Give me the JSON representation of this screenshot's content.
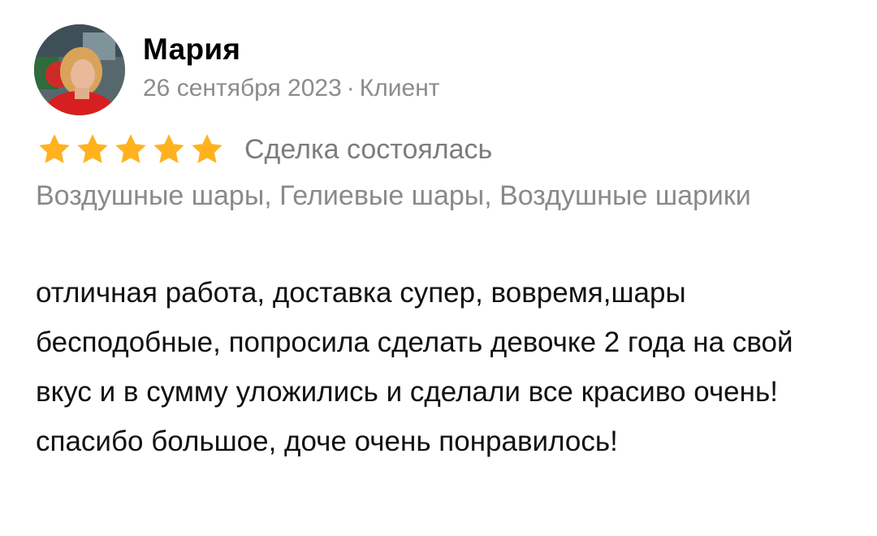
{
  "review": {
    "author": "Мария",
    "date": "26 сентября 2023",
    "separator": "·",
    "role": "Клиент",
    "rating": 5,
    "rating_max": 5,
    "deal_status": "Сделка состоялась",
    "categories": "Воздушные шары, Гелиевые шары, Воздушные шарики",
    "text": "отличная работа, доставка супер, вовремя,шары бесподобные, попросила сделать девочке 2 года на свой вкус и в сумму уложились и сделали все красиво очень! спасибо большое, доче очень понравилось!"
  },
  "colors": {
    "star": "#ffb21e",
    "muted_text": "#8c8c8c",
    "body_text": "#111111"
  },
  "icons": {
    "avatar": "user-photo",
    "star": "star-icon"
  }
}
